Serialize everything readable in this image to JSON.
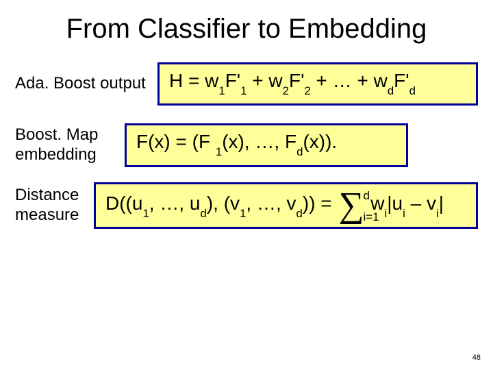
{
  "title": "From Classifier to Embedding",
  "rows": [
    {
      "label": "Ada. Boost output",
      "formula_parts": {
        "p0": "H = w",
        "s1": "1",
        "p1": "F'",
        "s2": "1",
        "p2": " + w",
        "s3": "2",
        "p3": "F'",
        "s4": "2",
        "p4": " + … + w",
        "s5": "d",
        "p5": "F'",
        "s6": "d"
      }
    },
    {
      "label_line1": "Boost. Map",
      "label_line2": "embedding",
      "formula_parts": {
        "p0": "F(x) = (F ",
        "s1": "1",
        "p1": "(x), …, F",
        "s2": "d",
        "p2": "(x))."
      }
    },
    {
      "label_line1": "Distance",
      "label_line2": "measure",
      "formula_parts": {
        "p0": "D((u",
        "s1": "1",
        "p1": ", …, u",
        "s2": "d",
        "p2": "), (v",
        "s3": "1",
        "p3": ", …, v",
        "s4": "d",
        "p4": ")) = ",
        "sigma_top": "d",
        "sigma_bot": "i=1",
        "p5": " w",
        "s5": "i",
        "p6": "|u",
        "s6": "i",
        "p7": " – v",
        "s7": "i",
        "p8": "|"
      }
    }
  ],
  "page_number": "48"
}
